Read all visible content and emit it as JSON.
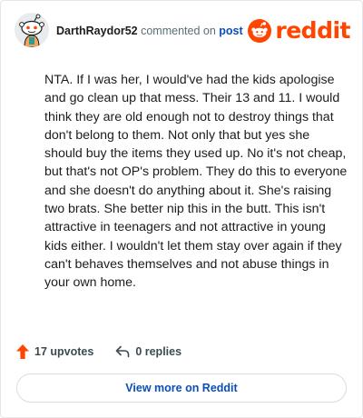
{
  "comment": {
    "username": "DarthRaydor52",
    "action_text": "commented on",
    "post_link": "post",
    "body": "NTA. If I was her, I would've had the kids apologise and go clean up that mess. Their 13 and 11. I would think they are old enough not to destroy things that don't belong to them. Not only that but yes she should buy the items they used up. No it's not cheap, but that's not OP's problem. They do this to everyone and she doesn't do anything about it. She's raising two brats. She better nip this in the butt. This isn't attractive in teenagers and not attractive in young kids either. I wouldn't let them stay over again if they can't behaves themselves and not abuse things in your own home."
  },
  "brand": {
    "wordmark": "reddit",
    "color": "#ff4500"
  },
  "actions": {
    "upvotes_label": "17 upvotes",
    "replies_label": "0 replies"
  },
  "footer": {
    "view_more_label": "View more on Reddit"
  },
  "icons": {
    "avatar": "snoo-avatar-icon",
    "logo": "reddit-snoo-icon",
    "upvote": "upvote-arrow-icon",
    "reply": "reply-arrow-icon"
  },
  "colors": {
    "accent": "#ff4500",
    "link": "#0a4fb8",
    "text": "#1c1c1c",
    "muted": "#576f76"
  }
}
